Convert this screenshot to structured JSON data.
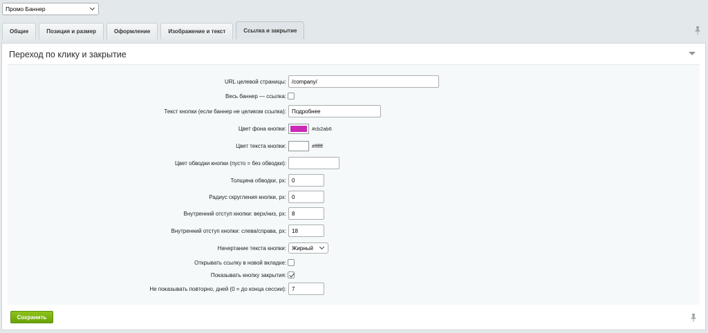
{
  "top_select": {
    "value": "Промо Баннер"
  },
  "tabs": [
    {
      "label": "Общие"
    },
    {
      "label": "Позиция и размер"
    },
    {
      "label": "Оформление"
    },
    {
      "label": "Изображение и текст"
    },
    {
      "label": "Ссылка и закрытие",
      "active": true
    }
  ],
  "panel": {
    "title": "Переход по клику и закрытие"
  },
  "fields": {
    "url": {
      "label": "URL целевой страницы:",
      "value": "/company/"
    },
    "whole_link": {
      "label": "Весь баннер — ссылка:",
      "checked": false
    },
    "button_text": {
      "label": "Текст кнопки (если баннер не целиком ссылка):",
      "value": "Подробнее"
    },
    "bg_color": {
      "label": "Цвет фона кнопки:",
      "value": "#cb2ab6"
    },
    "text_color": {
      "label": "Цвет текста кнопки:",
      "value": "#ffffff"
    },
    "border_color": {
      "label": "Цвет обводки кнопки (пусто = без обводки):",
      "value": ""
    },
    "border_width": {
      "label": "Толщина обводки, px:",
      "value": "0"
    },
    "radius": {
      "label": "Радиус скругления кнопки, px:",
      "value": "0"
    },
    "pad_v": {
      "label": "Внутренний отступ кнопки: верх/низ, px:",
      "value": "8"
    },
    "pad_h": {
      "label": "Внутренний отступ кнопки: слева/справа, px:",
      "value": "18"
    },
    "font_weight": {
      "label": "Начертание текста кнопки:",
      "value": "Жирный"
    },
    "new_tab": {
      "label": "Открывать ссылку в новой вкладке:",
      "checked": false
    },
    "show_close": {
      "label": "Показывать кнопку закрытия:",
      "checked": true
    },
    "no_repeat": {
      "label": "Не показывать повторно, дней (0 = до конца сессии):",
      "value": "7"
    }
  },
  "save_button": {
    "label": "Сохранить"
  },
  "colors": {
    "accent": "#6aa307",
    "bg_swatch": "#cb2ab6",
    "text_swatch": "#ffffff"
  }
}
